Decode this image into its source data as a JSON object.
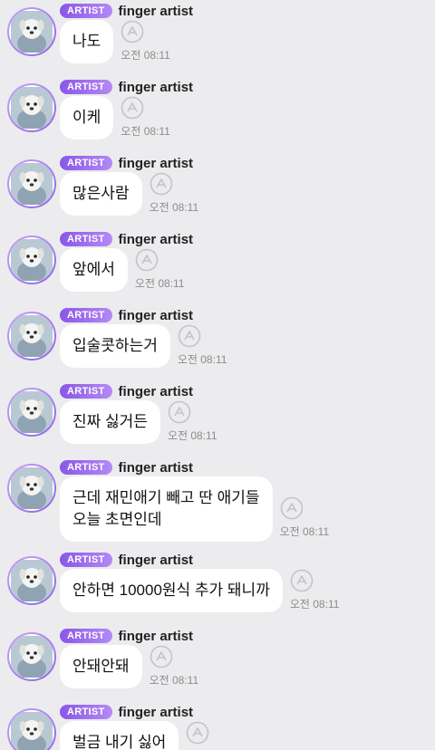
{
  "messages": [
    {
      "badge": "ARTIST",
      "sender": "finger artist",
      "text": "나도",
      "time": "오전 08:11"
    },
    {
      "badge": "ARTIST",
      "sender": "finger artist",
      "text": "이케",
      "time": "오전 08:11"
    },
    {
      "badge": "ARTIST",
      "sender": "finger artist",
      "text": "많은사람",
      "time": "오전 08:11"
    },
    {
      "badge": "ARTIST",
      "sender": "finger artist",
      "text": "앞에서",
      "time": "오전 08:11"
    },
    {
      "badge": "ARTIST",
      "sender": "finger artist",
      "text": "입술콧하는거",
      "time": "오전 08:11"
    },
    {
      "badge": "ARTIST",
      "sender": "finger artist",
      "text": "진짜 싫거든",
      "time": "오전 08:11"
    },
    {
      "badge": "ARTIST",
      "sender": "finger artist",
      "text": "근데 재민애기 빼고 딴 애기들\n오늘 초면인데",
      "time": "오전 08:11"
    },
    {
      "badge": "ARTIST",
      "sender": "finger artist",
      "text": "안하면 10000원식 추가 돼니까",
      "time": "오전 08:11"
    },
    {
      "badge": "ARTIST",
      "sender": "finger artist",
      "text": "안돼안돼",
      "time": "오전 08:11"
    },
    {
      "badge": "ARTIST",
      "sender": "finger artist",
      "text": "벌금 내기 싫어",
      "time": ""
    }
  ],
  "colors": {
    "background": "#ececee",
    "bubble": "#ffffff",
    "badge_start": "#8a57e6",
    "badge_end": "#b38af5",
    "time": "#8c8c8c"
  },
  "icons": {
    "avatar": "dog-avatar-icon",
    "reaction": "reaction-add-icon"
  }
}
